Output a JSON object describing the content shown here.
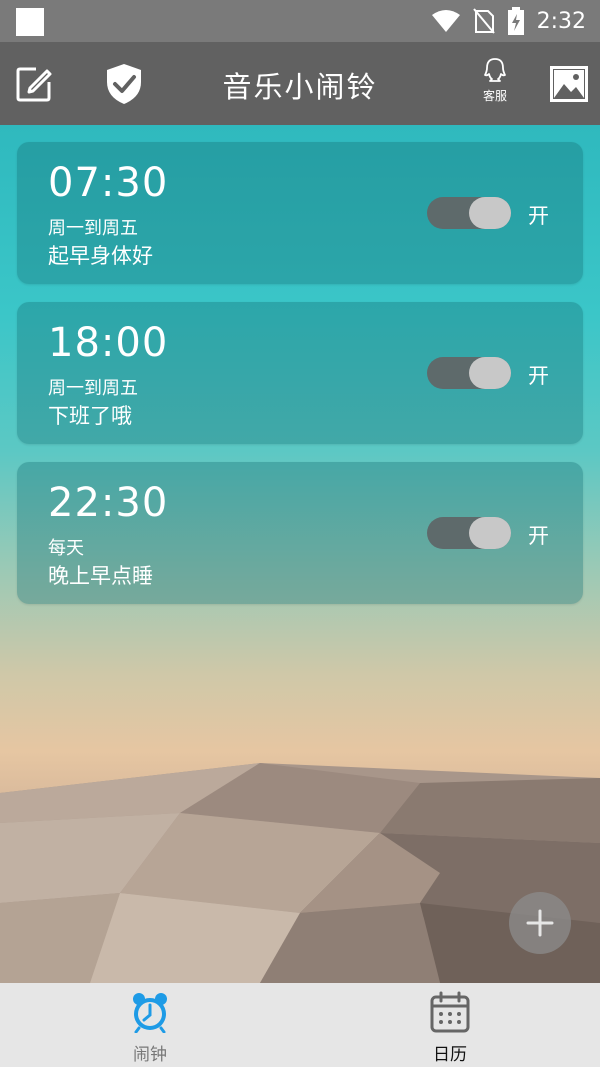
{
  "status_bar": {
    "time": "2:32"
  },
  "app_bar": {
    "title": "音乐小闹铃",
    "service_label": "客服"
  },
  "alarms": [
    {
      "time": "07:30",
      "days": "周一到周五",
      "label": "起早身体好",
      "toggle_text": "开"
    },
    {
      "time": "18:00",
      "days": "周一到周五",
      "label": "下班了哦",
      "toggle_text": "开"
    },
    {
      "time": "22:30",
      "days": "每天",
      "label": "晚上早点睡",
      "toggle_text": "开"
    }
  ],
  "bottom_nav": {
    "items": [
      {
        "label": "闹钟",
        "icon": "alarm-clock-icon"
      },
      {
        "label": "日历",
        "icon": "calendar-icon"
      }
    ]
  },
  "colors": {
    "accent": "#1e9be6",
    "app_bar": "#616161",
    "status_bar": "#7a7a7a",
    "nav_background": "#e6e6e6"
  }
}
